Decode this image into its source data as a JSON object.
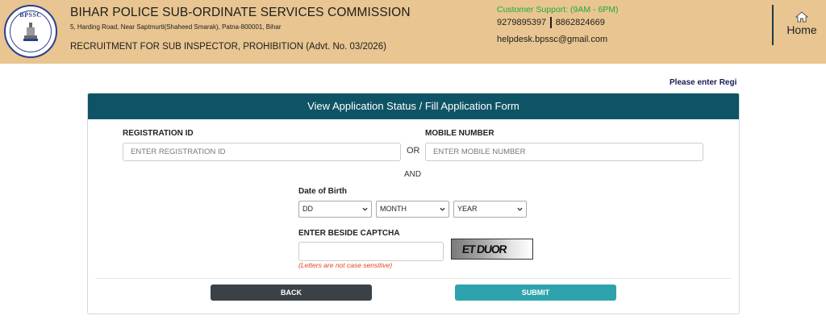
{
  "header": {
    "logo_text": "BPSSC",
    "title": "BIHAR POLICE SUB-ORDINATE SERVICES COMMISSION",
    "address": "5, Harding Road, Near Saptmurti(Shaheed Smarak), Patna-800001, Bihar",
    "recruitment": "RECRUITMENT FOR SUB INSPECTOR, PROHIBITION (Advt. No. 03/2026)",
    "support_label": "Customer Support: (9AM - 6PM)",
    "phone_1": "9279895397",
    "phone_2": "8862824669",
    "email": "helpdesk.bpssc@gmail.com",
    "home_label": "Home"
  },
  "notice": "Please enter Regi",
  "form": {
    "heading": "View Application Status / Fill Application Form",
    "registration_label": "REGISTRATION ID",
    "registration_placeholder": "ENTER REGISTRATION ID",
    "or_text": "OR",
    "mobile_label": "MOBILE NUMBER",
    "mobile_placeholder": "ENTER MOBILE NUMBER",
    "and_text": "AND",
    "dob_label": "Date of Birth",
    "day_value": "DD",
    "month_value": "MONTH",
    "year_value": "YEAR",
    "captcha_label": "ENTER BESIDE CAPTCHA",
    "captcha_text": "ET DUOR",
    "captcha_hint": "(Letters are not case sensitive)",
    "back_label": "BACK",
    "submit_label": "SUBMIT"
  },
  "colors": {
    "header_bg": "#e8c591",
    "panel_head": "#0f5466",
    "support_green": "#1faa3e",
    "back_button": "#3a4248",
    "submit_button": "#2fa3ad",
    "hint_red": "#e0461e"
  }
}
